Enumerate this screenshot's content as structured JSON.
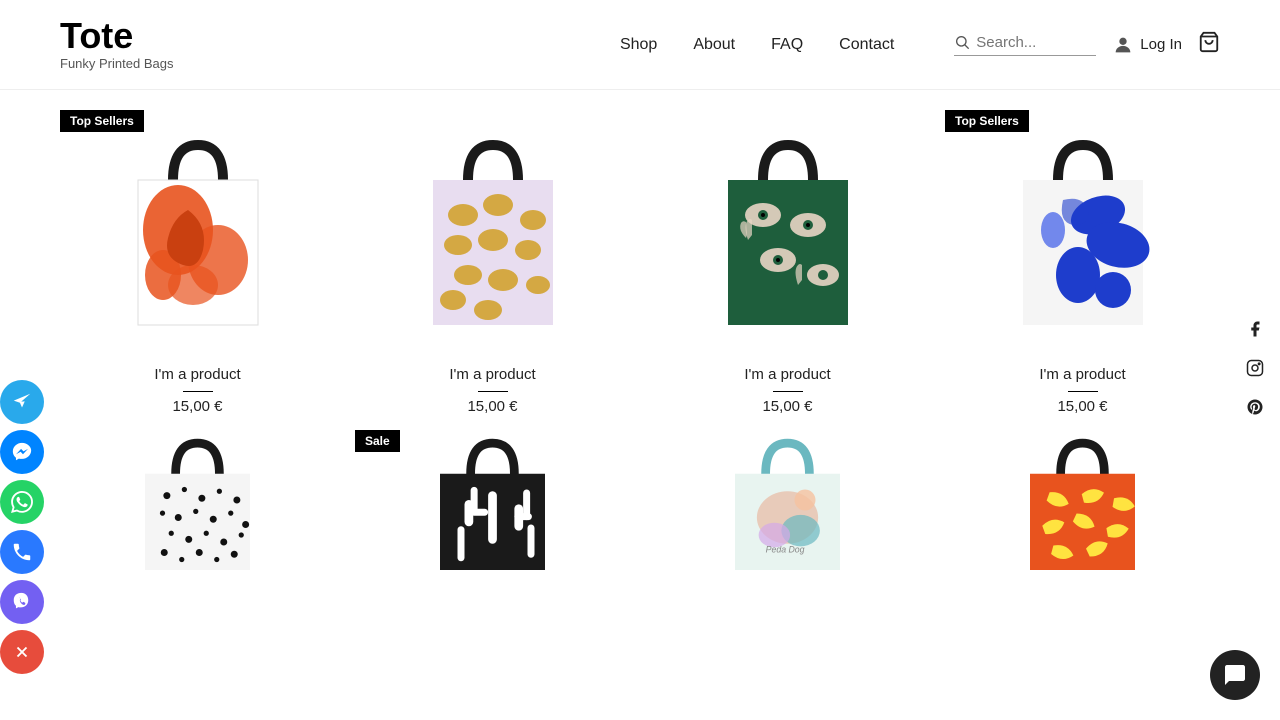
{
  "site": {
    "title": "Tote",
    "subtitle": "Funky Printed Bags"
  },
  "nav": {
    "items": [
      {
        "label": "Shop",
        "id": "shop"
      },
      {
        "label": "About",
        "id": "about"
      },
      {
        "label": "FAQ",
        "id": "faq"
      },
      {
        "label": "Contact",
        "id": "contact"
      }
    ]
  },
  "header": {
    "search_placeholder": "Search...",
    "login_label": "Log In"
  },
  "badges": {
    "top_sellers": "Top Sellers",
    "sale": "Sale"
  },
  "products": [
    {
      "id": "p1",
      "name": "I'm a product",
      "price": "15,00 €",
      "badge": "Top Sellers",
      "pattern": "orange-abstract",
      "row": 1
    },
    {
      "id": "p2",
      "name": "I'm a product",
      "price": "15,00 €",
      "badge": null,
      "pattern": "lavender-lemons",
      "row": 1
    },
    {
      "id": "p3",
      "name": "I'm a product",
      "price": "15,00 €",
      "badge": null,
      "pattern": "green-eyes",
      "row": 1
    },
    {
      "id": "p4",
      "name": "I'm a product",
      "price": "15,00 €",
      "badge": "Top Sellers",
      "pattern": "blue-abstract",
      "row": 1
    },
    {
      "id": "p5",
      "name": "I'm a product",
      "price": "15,00 €",
      "badge": null,
      "pattern": "black-dots",
      "row": 2
    },
    {
      "id": "p6",
      "name": "I'm a product",
      "price": "15,00 €",
      "badge": "Sale",
      "pattern": "black-cactus",
      "row": 2
    },
    {
      "id": "p7",
      "name": "I'm a product",
      "price": "15,00 €",
      "badge": null,
      "pattern": "pastel-fox",
      "row": 2
    },
    {
      "id": "p8",
      "name": "I'm a product",
      "price": "15,00 €",
      "badge": null,
      "pattern": "orange-bananas",
      "row": 2
    }
  ],
  "social": {
    "items": [
      {
        "id": "telegram",
        "label": "Telegram",
        "color": "#29a9eb"
      },
      {
        "id": "messenger",
        "label": "Messenger",
        "color": "#0084ff"
      },
      {
        "id": "whatsapp",
        "label": "WhatsApp",
        "color": "#25d366"
      },
      {
        "id": "phone",
        "label": "Phone",
        "color": "#2979ff"
      },
      {
        "id": "viber",
        "label": "Viber",
        "color": "#7360f2"
      },
      {
        "id": "close",
        "label": "Close",
        "color": "#e74c3c"
      }
    ]
  },
  "right_social": [
    {
      "id": "facebook",
      "label": "Facebook"
    },
    {
      "id": "instagram",
      "label": "Instagram"
    },
    {
      "id": "pinterest",
      "label": "Pinterest"
    }
  ],
  "chat": {
    "label": "Chat"
  }
}
